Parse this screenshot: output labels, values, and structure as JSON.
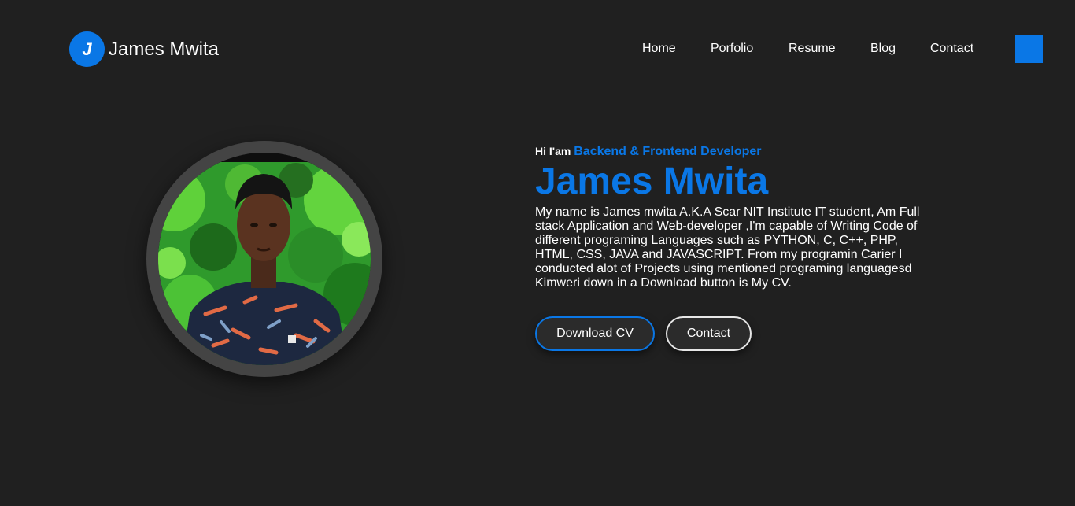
{
  "brand": {
    "initial": "J",
    "name": "James Mwita"
  },
  "nav": {
    "items": [
      "Home",
      "Porfolio",
      "Resume",
      "Blog",
      "Contact"
    ]
  },
  "hero": {
    "greeting": "Hi I'am",
    "role": "Backend & Frontend Developer",
    "name": "James Mwita",
    "bio": "My name is James mwita A.K.A Scar NIT Institute IT student, Am Full stack Application and Web-developer ,I'm capable of Writing Code of different programing Languages such as PYTHON, C, C++, PHP, HTML, CSS, JAVA and JAVASCRIPT. From my programin Carier I conducted alot of Projects using mentioned programing languagesd Kimweri down in a Download button is My CV.",
    "download_label": "Download CV",
    "contact_label": "Contact"
  },
  "colors": {
    "accent": "#0a77e6",
    "background": "#202020",
    "ring": "#444444"
  }
}
